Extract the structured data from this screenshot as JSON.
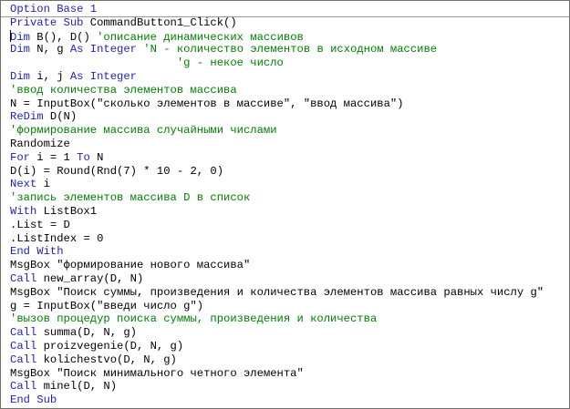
{
  "editor": {
    "lines": [
      [
        {
          "type": "kw",
          "text": "Option Base 1"
        }
      ],
      [
        {
          "type": "kw",
          "text": "Private Sub"
        },
        {
          "type": "tx",
          "text": " CommandButton1_Click()"
        }
      ],
      [
        {
          "type": "kw",
          "text": "Dim"
        },
        {
          "type": "tx",
          "text": " B(), D() "
        },
        {
          "type": "cm",
          "text": "'описание динамических массивов"
        }
      ],
      [
        {
          "type": "kw",
          "text": "Dim"
        },
        {
          "type": "tx",
          "text": " N, g "
        },
        {
          "type": "kw",
          "text": "As Integer"
        },
        {
          "type": "cm",
          "text": " 'N - количество элементов в исходном массиве"
        }
      ],
      [
        {
          "type": "cm",
          "text": "                         'g - некое число"
        }
      ],
      [
        {
          "type": "kw",
          "text": "Dim"
        },
        {
          "type": "tx",
          "text": " i, j "
        },
        {
          "type": "kw",
          "text": "As Integer"
        }
      ],
      [
        {
          "type": "cm",
          "text": "'ввод количества элементов массива"
        }
      ],
      [
        {
          "type": "tx",
          "text": "N = InputBox(\"сколько элементов в массиве\", \"ввод массива\")"
        }
      ],
      [
        {
          "type": "kw",
          "text": "ReDim"
        },
        {
          "type": "tx",
          "text": " D(N)"
        }
      ],
      [
        {
          "type": "cm",
          "text": "'формирование массива случайными числами"
        }
      ],
      [
        {
          "type": "tx",
          "text": "Randomize"
        }
      ],
      [
        {
          "type": "kw",
          "text": "For"
        },
        {
          "type": "tx",
          "text": " i = 1 "
        },
        {
          "type": "kw",
          "text": "To"
        },
        {
          "type": "tx",
          "text": " N"
        }
      ],
      [
        {
          "type": "tx",
          "text": "D(i) = Round(Rnd(7) * 10 - 2, 0)"
        }
      ],
      [
        {
          "type": "kw",
          "text": "Next"
        },
        {
          "type": "tx",
          "text": " i"
        }
      ],
      [
        {
          "type": "cm",
          "text": "'запись элементов массива D в список"
        }
      ],
      [
        {
          "type": "kw",
          "text": "With"
        },
        {
          "type": "tx",
          "text": " ListBox1"
        }
      ],
      [
        {
          "type": "tx",
          "text": ".List = D"
        }
      ],
      [
        {
          "type": "tx",
          "text": ".ListIndex = 0"
        }
      ],
      [
        {
          "type": "kw",
          "text": "End With"
        }
      ],
      [
        {
          "type": "tx",
          "text": "MsgBox \"формирование нового массива\""
        }
      ],
      [
        {
          "type": "kw",
          "text": "Call"
        },
        {
          "type": "tx",
          "text": " new_array(D, N)"
        }
      ],
      [
        {
          "type": "tx",
          "text": "MsgBox \"Поиск суммы, произведения и количества элементов массива равных числу g\""
        }
      ],
      [
        {
          "type": "tx",
          "text": "g = InputBox(\"введи число g\")"
        }
      ],
      [
        {
          "type": "cm",
          "text": "'вызов процедур поиска суммы, произведения и количества"
        }
      ],
      [
        {
          "type": "kw",
          "text": "Call"
        },
        {
          "type": "tx",
          "text": " summa(D, N, g)"
        }
      ],
      [
        {
          "type": "kw",
          "text": "Call"
        },
        {
          "type": "tx",
          "text": " proizvegenie(D, N, g)"
        }
      ],
      [
        {
          "type": "kw",
          "text": "Call"
        },
        {
          "type": "tx",
          "text": " kolichestvo(D, N, g)"
        }
      ],
      [
        {
          "type": "tx",
          "text": "MsgBox \"Поиск минимального четного элемента\""
        }
      ],
      [
        {
          "type": "kw",
          "text": "Call"
        },
        {
          "type": "tx",
          "text": " minel(D, N)"
        }
      ],
      [
        {
          "type": "kw",
          "text": "End Sub"
        }
      ]
    ],
    "colors": {
      "keyword": "#1f1fbd",
      "comment": "#008000",
      "text": "#000000",
      "background": "#ffffff"
    }
  }
}
